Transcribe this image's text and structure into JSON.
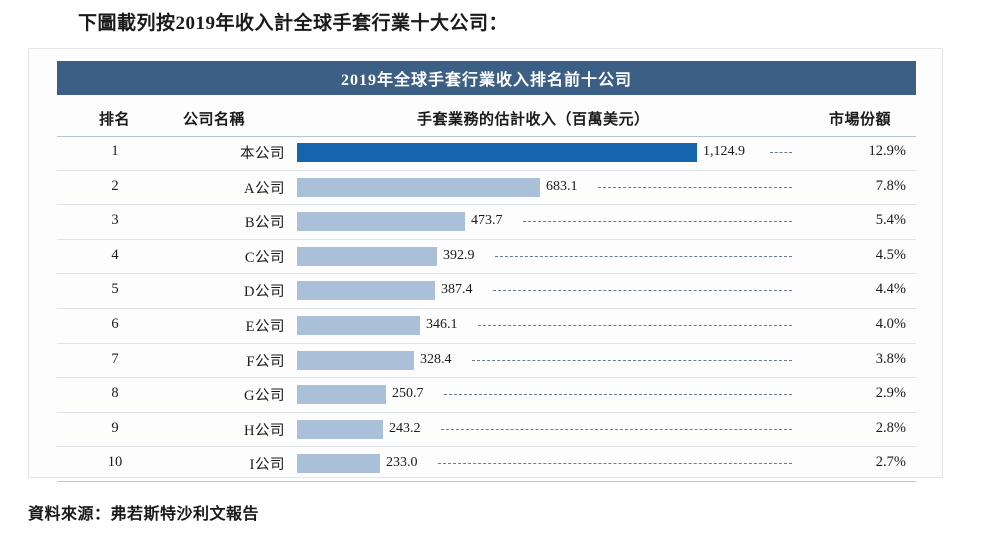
{
  "caption": "下圖載列按2019年收入計全球手套行業十大公司：",
  "card": {
    "title": "2019年全球手套行業收入排名前十公司",
    "headers": {
      "rank": "排名",
      "company": "公司名稱",
      "revenue": "手套業務的估計收入（百萬美元）",
      "share": "市場份額"
    }
  },
  "source": "資料來源：弗若斯特沙利文報告",
  "chart_data": {
    "type": "bar",
    "title": "2019年全球手套行業收入排名前十公司",
    "xlabel": "手套業務的估計收入（百萬美元）",
    "ylabel": "公司名稱",
    "orientation": "horizontal",
    "grid": false,
    "legend": "none",
    "xlim": [
      0,
      1124.9
    ],
    "columns": [
      "排名",
      "公司名稱",
      "手套業務的估計收入（百萬美元）",
      "市場份額"
    ],
    "categories": [
      "本公司",
      "A公司",
      "B公司",
      "C公司",
      "D公司",
      "E公司",
      "F公司",
      "G公司",
      "H公司",
      "I公司"
    ],
    "values": [
      1124.9,
      683.1,
      473.7,
      392.9,
      387.4,
      346.1,
      328.4,
      250.7,
      243.2,
      233.0
    ],
    "value_labels": [
      "1,124.9",
      "683.1",
      "473.7",
      "392.9",
      "387.4",
      "346.1",
      "328.4",
      "250.7",
      "243.2",
      "233.0"
    ],
    "share_labels": [
      "12.9%",
      "7.8%",
      "5.4%",
      "4.5%",
      "4.4%",
      "4.0%",
      "3.8%",
      "2.9%",
      "2.8%",
      "2.7%"
    ],
    "ranks": [
      "1",
      "2",
      "3",
      "4",
      "5",
      "6",
      "7",
      "8",
      "9",
      "10"
    ],
    "colors": {
      "highlight_bar": "#1565ad",
      "bar": "#aac0d8",
      "title_bar": "#3c5f85"
    },
    "rows": [
      {
        "rank": "1",
        "company": "本公司",
        "value": 1124.9,
        "value_label": "1,124.9",
        "share": "12.9%"
      },
      {
        "rank": "2",
        "company": "A公司",
        "value": 683.1,
        "value_label": "683.1",
        "share": "7.8%"
      },
      {
        "rank": "3",
        "company": "B公司",
        "value": 473.7,
        "value_label": "473.7",
        "share": "5.4%"
      },
      {
        "rank": "4",
        "company": "C公司",
        "value": 392.9,
        "value_label": "392.9",
        "share": "4.5%"
      },
      {
        "rank": "5",
        "company": "D公司",
        "value": 387.4,
        "value_label": "387.4",
        "share": "4.4%"
      },
      {
        "rank": "6",
        "company": "E公司",
        "value": 346.1,
        "value_label": "346.1",
        "share": "4.0%"
      },
      {
        "rank": "7",
        "company": "F公司",
        "value": 328.4,
        "value_label": "328.4",
        "share": "3.8%"
      },
      {
        "rank": "8",
        "company": "G公司",
        "value": 250.7,
        "value_label": "250.7",
        "share": "2.9%"
      },
      {
        "rank": "9",
        "company": "H公司",
        "value": 243.2,
        "value_label": "243.2",
        "share": "2.8%"
      },
      {
        "rank": "10",
        "company": "I公司",
        "value": 233.0,
        "value_label": "233.0",
        "share": "2.7%"
      }
    ]
  }
}
